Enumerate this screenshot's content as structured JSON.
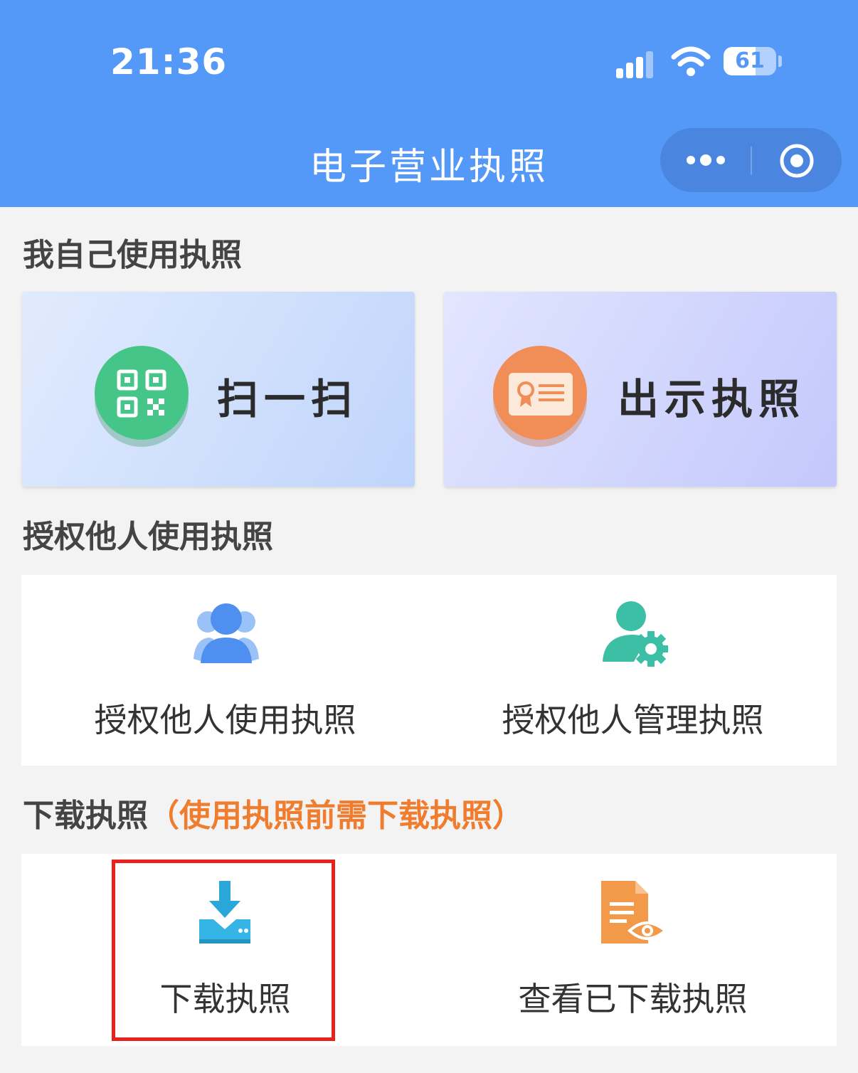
{
  "status_bar": {
    "time": "21:36",
    "battery": "61",
    "battery_level": 0.61
  },
  "nav": {
    "title": "电子营业执照"
  },
  "colors": {
    "header": "#5499f8",
    "highlight_border": "#e8221a",
    "hint": "#f07d2e"
  },
  "icons": {
    "signal": "signal-icon",
    "wifi": "wifi-icon",
    "more": "more-dots-icon",
    "close": "target-circle-icon",
    "scan": "qr-code-icon",
    "show": "certificate-card-icon",
    "auth_use": "users-icon",
    "auth_manage": "user-gear-icon",
    "download": "download-tray-icon",
    "view": "document-eye-icon"
  },
  "sections": {
    "self_use": {
      "title": "我自己使用执照",
      "cards": {
        "scan": "扫一扫",
        "show": "出示执照"
      }
    },
    "authorize": {
      "title": "授权他人使用执照",
      "items": {
        "use": "授权他人使用执照",
        "manage": "授权他人管理执照"
      }
    },
    "download": {
      "title": "下载执照",
      "hint": "（使用执照前需下载执照）",
      "items": {
        "download": "下载执照",
        "view": "查看已下载执照"
      }
    }
  }
}
